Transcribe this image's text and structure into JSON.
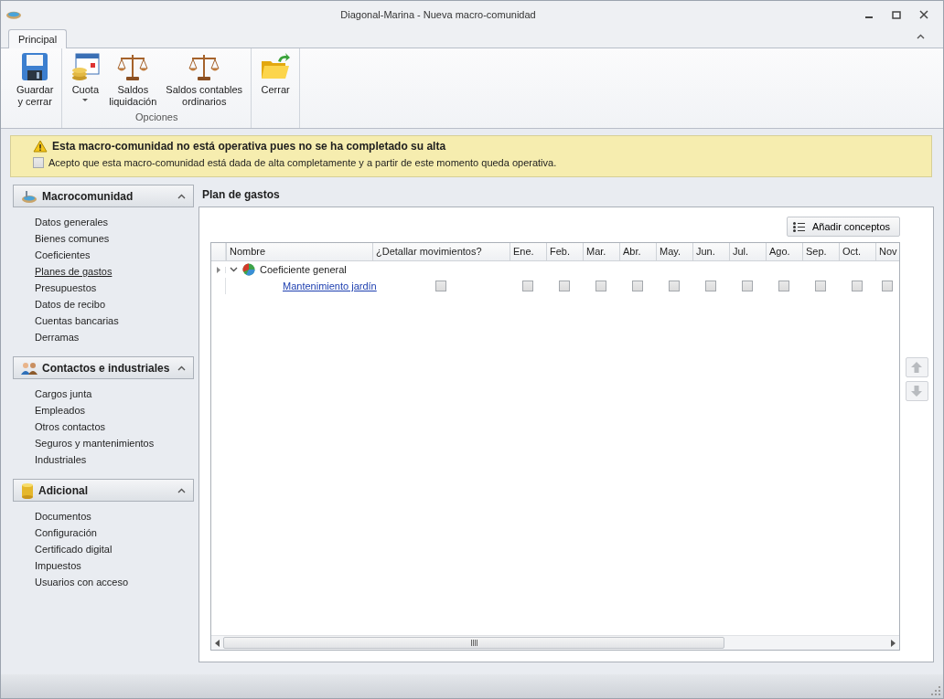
{
  "window": {
    "title": "Diagonal-Marina - Nueva macro-comunidad"
  },
  "ribbon": {
    "tabs": [
      {
        "label": "Principal",
        "selected": true
      }
    ],
    "groups": [
      {
        "buttons": [
          {
            "kind": "save",
            "label": "Guardar\ny cerrar",
            "dropdown": false
          }
        ]
      },
      {
        "label": "Opciones",
        "buttons": [
          {
            "kind": "fee",
            "label": "Cuota",
            "dropdown": true
          },
          {
            "kind": "scales",
            "label": "Saldos\nliquidación",
            "dropdown": false
          },
          {
            "kind": "scales",
            "label": "Saldos contables\nordinarios",
            "dropdown": false
          }
        ]
      },
      {
        "buttons": [
          {
            "kind": "close",
            "label": "Cerrar",
            "dropdown": false
          }
        ]
      }
    ]
  },
  "warning": {
    "title": "Esta macro-comunidad no está operativa pues no se ha completado su alta",
    "accept_label": "Acepto que esta macro-comunidad está dada de alta completamente y a partir de este momento queda operativa.",
    "accepted": false
  },
  "sidebar": [
    {
      "kind": "community",
      "title": "Macrocomunidad",
      "expanded": true,
      "items": [
        {
          "label": "Datos generales",
          "selected": false
        },
        {
          "label": "Bienes comunes",
          "selected": false
        },
        {
          "label": "Coeficientes",
          "selected": false
        },
        {
          "label": "Planes de gastos",
          "selected": true
        },
        {
          "label": "Presupuestos",
          "selected": false
        },
        {
          "label": "Datos de recibo",
          "selected": false
        },
        {
          "label": "Cuentas bancarias",
          "selected": false
        },
        {
          "label": "Derramas",
          "selected": false
        }
      ]
    },
    {
      "kind": "contacts",
      "title": "Contactos e industriales",
      "expanded": true,
      "items": [
        {
          "label": "Cargos junta",
          "selected": false
        },
        {
          "label": "Empleados",
          "selected": false
        },
        {
          "label": "Otros contactos",
          "selected": false
        },
        {
          "label": "Seguros y mantenimientos",
          "selected": false
        },
        {
          "label": "Industriales",
          "selected": false
        }
      ]
    },
    {
      "kind": "extra",
      "title": "Adicional",
      "expanded": true,
      "items": [
        {
          "label": "Documentos",
          "selected": false
        },
        {
          "label": "Configuración",
          "selected": false
        },
        {
          "label": "Certificado digital",
          "selected": false
        },
        {
          "label": "Impuestos",
          "selected": false
        },
        {
          "label": "Usuarios con acceso",
          "selected": false
        }
      ]
    }
  ],
  "content": {
    "title": "Plan de gastos",
    "add_button": "Añadir conceptos",
    "columns": [
      "Nombre",
      "¿Detallar movimientos?",
      "Ene.",
      "Feb.",
      "Mar.",
      "Abr.",
      "May.",
      "Jun.",
      "Jul.",
      "Ago.",
      "Sep.",
      "Oct.",
      "Nov"
    ],
    "group": {
      "label": "Coeficiente general",
      "expanded": true,
      "rows": [
        {
          "label": "Mantenimiento jardín",
          "detail": false,
          "months": [
            false,
            false,
            false,
            false,
            false,
            false,
            false,
            false,
            false,
            false,
            false
          ]
        }
      ]
    }
  }
}
